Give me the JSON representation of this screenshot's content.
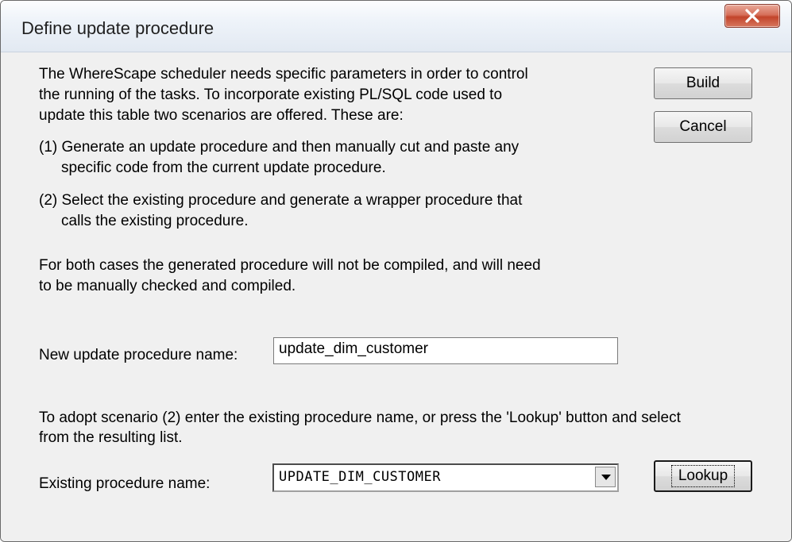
{
  "window": {
    "title": "Define update procedure"
  },
  "intro": {
    "line1": "The WhereScape scheduler needs specific parameters in order to control",
    "line2": "the running of the tasks. To incorporate existing PL/SQL code used to",
    "line3": "update this table two scenarios are offered. These are:"
  },
  "scenarios": {
    "s1_line1": "(1) Generate an update procedure and then manually cut and paste any",
    "s1_line2": "specific code from the current update procedure.",
    "s2_line1": "(2) Select the existing procedure and generate a wrapper procedure that",
    "s2_line2": "calls the existing procedure."
  },
  "note": {
    "line1": "For both cases the generated procedure will not be compiled, and will need",
    "line2": "to be manually checked and compiled."
  },
  "new_proc": {
    "label": "New update procedure name:",
    "value": "update_dim_customer"
  },
  "adopt": {
    "line1": "To adopt scenario (2) enter the existing procedure name, or press the 'Lookup' button and select",
    "line2": "from the resulting list."
  },
  "existing_proc": {
    "label": "Existing procedure name:",
    "value": "UPDATE_DIM_CUSTOMER"
  },
  "buttons": {
    "build": "Build",
    "cancel": "Cancel",
    "lookup": "Lookup"
  },
  "icons": {
    "close": "close-icon",
    "dropdown": "chevron-down-icon"
  },
  "colors": {
    "dialog_bg": "#f0f0f0",
    "close_button": "#c2442a"
  }
}
